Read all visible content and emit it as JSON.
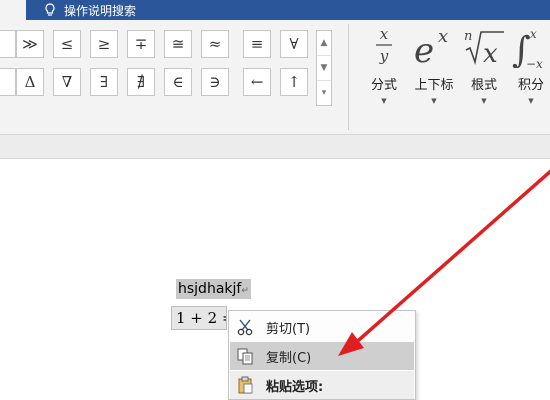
{
  "ribbon": {
    "tell_me_label": "操作说明搜索",
    "symbols": [
      "≫",
      "≤",
      "≥",
      "∓",
      "≅",
      "≈",
      "≡",
      "∀",
      "Δ",
      "∇",
      "∃",
      "∄",
      "∈",
      "∋",
      "←",
      "↑"
    ],
    "structures": [
      {
        "label": "分式",
        "icon": "fraction-icon"
      },
      {
        "label": "上下标",
        "icon": "script-icon"
      },
      {
        "label": "根式",
        "icon": "radical-icon"
      },
      {
        "label": "积分",
        "icon": "integral-icon"
      }
    ]
  },
  "document": {
    "text_line": "hsjdhakjf",
    "equation": "1 + 2 = "
  },
  "context_menu": {
    "items": [
      {
        "label": "剪切(T)",
        "icon": "scissors-icon"
      },
      {
        "label": "复制(C)",
        "icon": "copy-icon"
      },
      {
        "label": "粘贴选项:",
        "icon": "paste-icon"
      }
    ]
  },
  "annotation": {
    "arrow_color": "#e02020"
  }
}
